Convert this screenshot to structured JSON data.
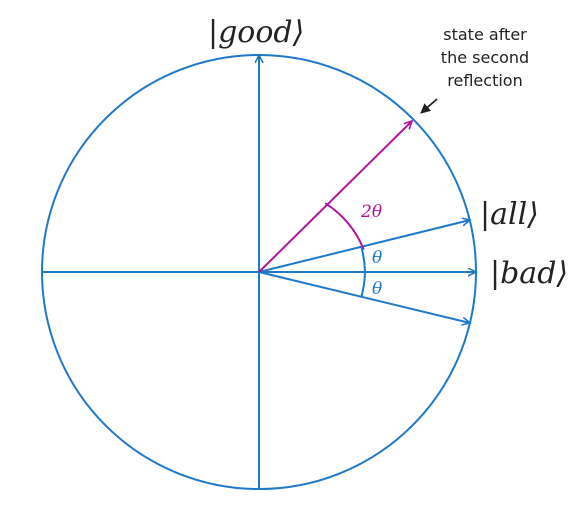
{
  "labels": {
    "good": "|good⟩",
    "all": "|all⟩",
    "bad": "|bad⟩",
    "two_theta": "2θ",
    "theta_upper": "θ",
    "theta_lower": "θ"
  },
  "annotation": {
    "line1": "state after",
    "line2": "the second",
    "line3": "reflection"
  },
  "colors": {
    "blue": "#1f78c8",
    "magenta": "#b0149b",
    "text": "#222222",
    "annotation_arrow": "#222222"
  }
}
